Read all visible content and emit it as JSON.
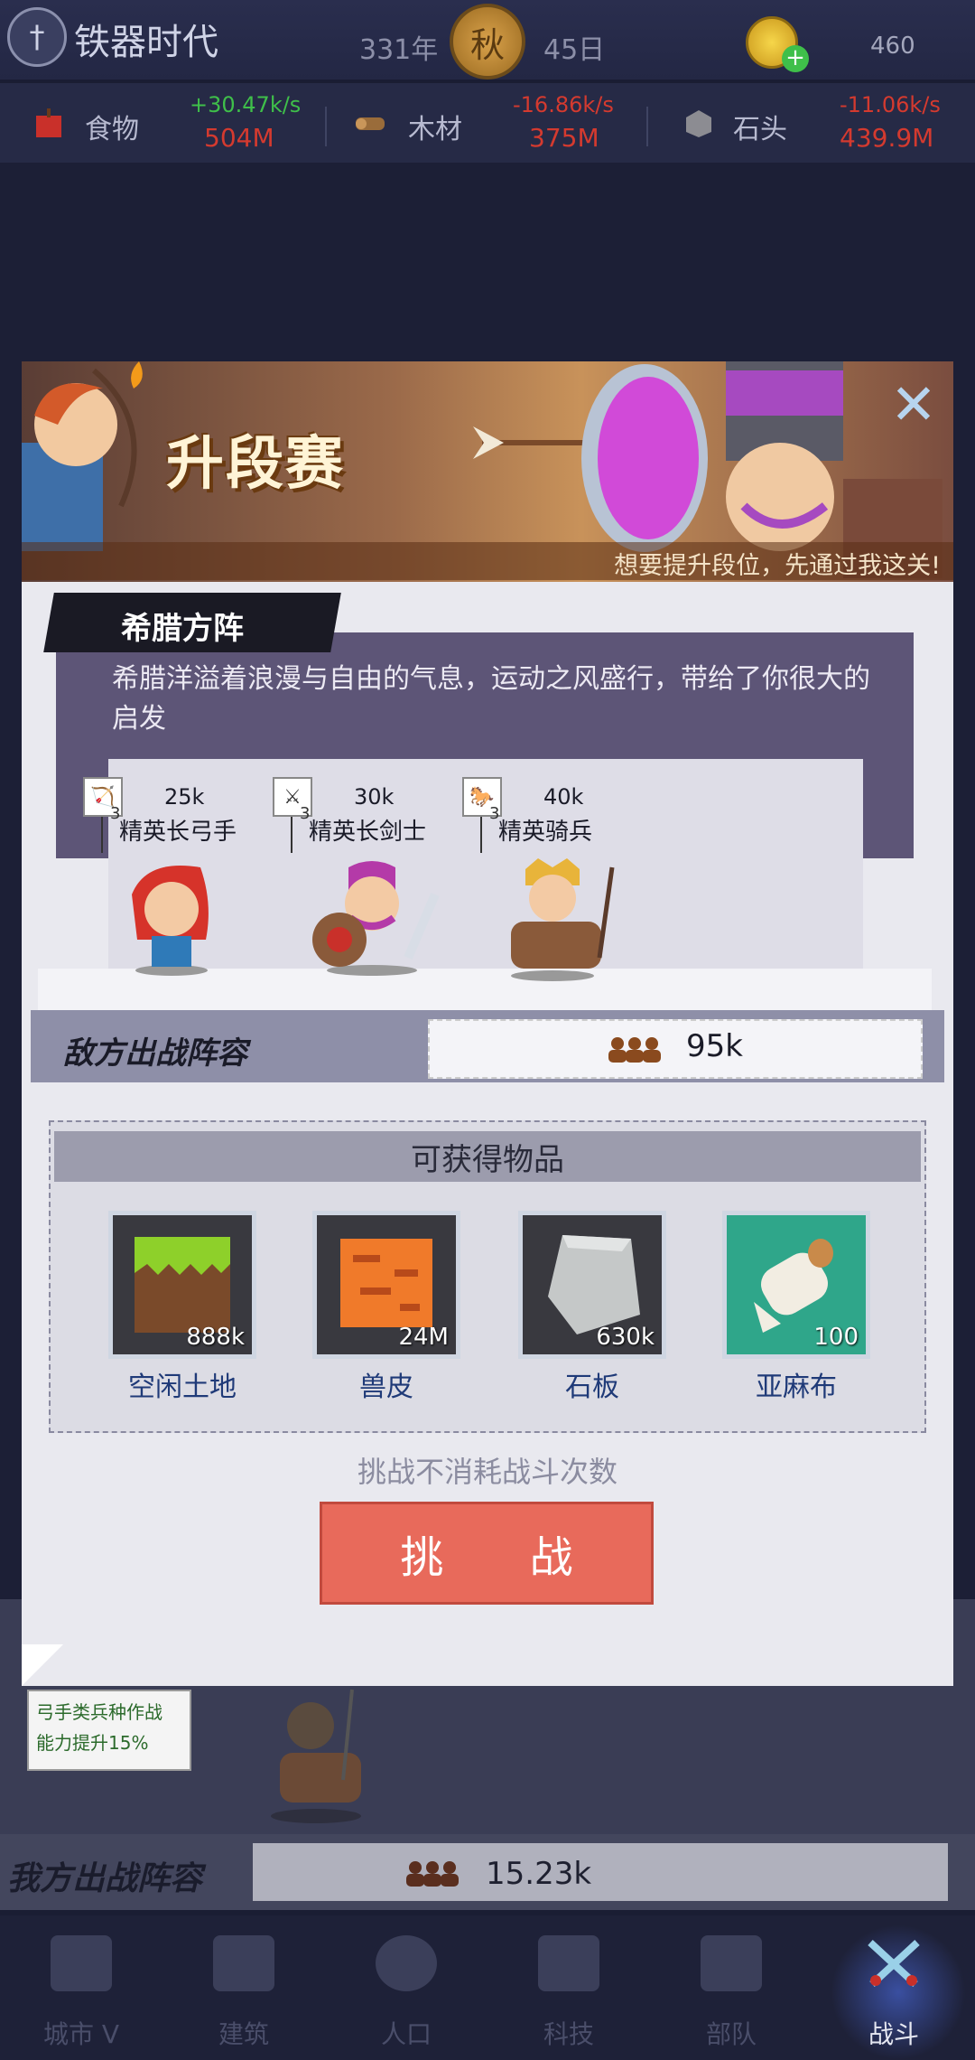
{
  "header": {
    "era_title": "铁器时代",
    "year": "331年",
    "season": "秋",
    "day": "45日",
    "coins": "460"
  },
  "resources": [
    {
      "name": "食物",
      "rate": "+30.47k/s",
      "amount": "504M",
      "rate_color": "#3fbf4a",
      "amount_color": "#d43a2f"
    },
    {
      "name": "木材",
      "rate": "-16.86k/s",
      "amount": "375M",
      "rate_color": "#d43a2f",
      "amount_color": "#d43a2f"
    },
    {
      "name": "石头",
      "rate": "-11.06k/s",
      "amount": "439.9M",
      "rate_color": "#d43a2f",
      "amount_color": "#d43a2f"
    }
  ],
  "modal": {
    "title": "升段赛",
    "subtitle": "想要提升段位，先通过我这关!",
    "close_icon": "close-icon",
    "stage_name": "希腊方阵",
    "stage_desc": "希腊洋溢着浪漫与自由的气息，运动之风盛行，带给了你很大的启发",
    "units": [
      {
        "name": "精英长弓手",
        "power": "25k",
        "level": "3",
        "icon": "bow-icon"
      },
      {
        "name": "精英长剑士",
        "power": "30k",
        "level": "3",
        "icon": "sword-icon"
      },
      {
        "name": "精英骑兵",
        "power": "40k",
        "level": "3",
        "icon": "horse-icon"
      }
    ],
    "enemy_label": "敌方出战阵容",
    "enemy_power": "95k",
    "rewards_title": "可获得物品",
    "rewards": [
      {
        "name": "空闲土地",
        "count": "888k"
      },
      {
        "name": "兽皮",
        "count": "24M"
      },
      {
        "name": "石板",
        "count": "630k"
      },
      {
        "name": "亚麻布",
        "count": "100"
      }
    ],
    "challenge_note": "挑战不消耗战斗次数",
    "challenge_button": "挑 战"
  },
  "behind": {
    "bonus_text_1": "弓手类兵种作战",
    "bonus_text_2": "能力提升15%",
    "ally_label": "我方出战阵容",
    "ally_power": "15.23k"
  },
  "nav": [
    {
      "label": "城市 V",
      "icon": "castle-icon"
    },
    {
      "label": "建筑",
      "icon": "house-icon"
    },
    {
      "label": "人口",
      "icon": "person-icon"
    },
    {
      "label": "科技",
      "icon": "book-icon"
    },
    {
      "label": "部队",
      "icon": "banner-icon"
    },
    {
      "label": "战斗",
      "icon": "crossed-swords-icon",
      "active": true
    }
  ]
}
